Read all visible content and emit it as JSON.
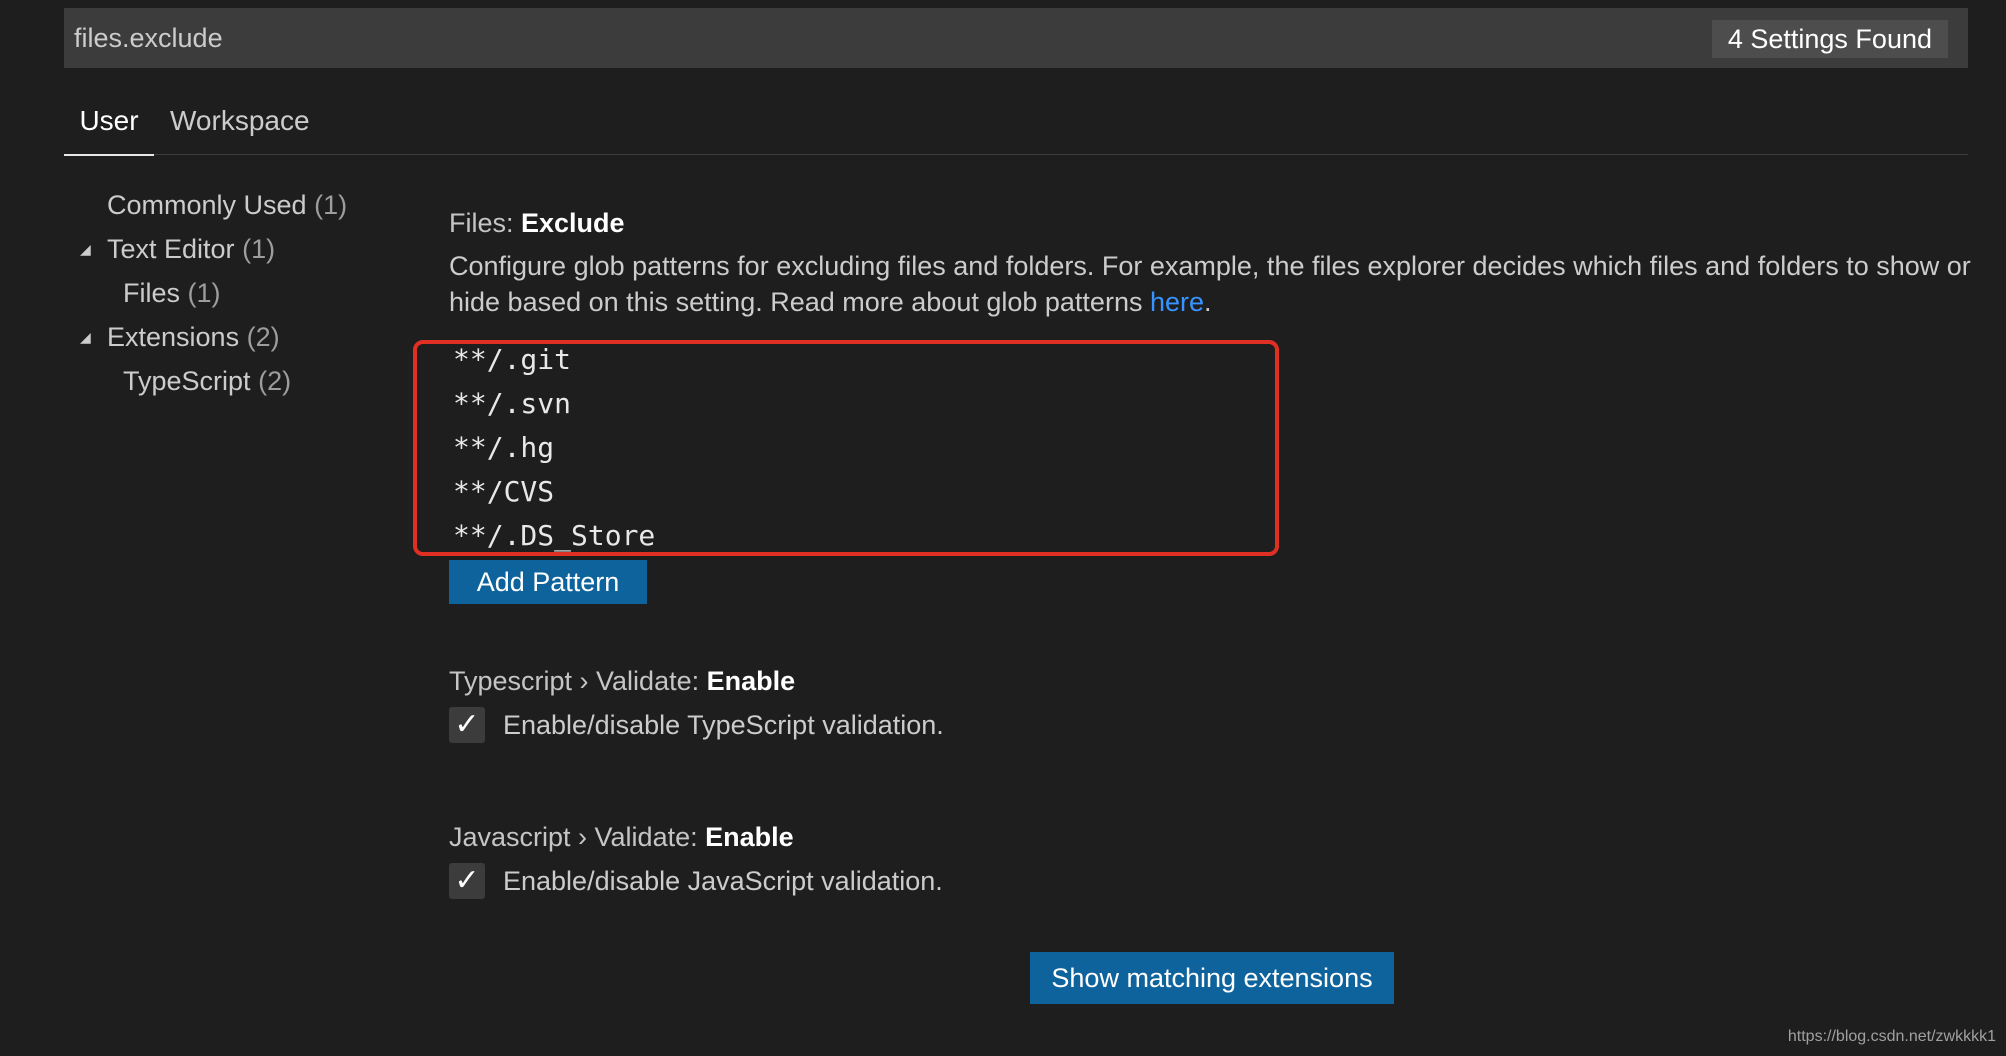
{
  "search": {
    "value": "files.exclude",
    "results_badge": "4 Settings Found"
  },
  "tabs": [
    {
      "label": "User"
    },
    {
      "label": "Workspace"
    }
  ],
  "toc": [
    {
      "label": "Commonly Used",
      "count": "(1)"
    },
    {
      "label": "Text Editor",
      "count": "(1)"
    },
    {
      "label": "Files",
      "count": "(1)"
    },
    {
      "label": "Extensions",
      "count": "(2)"
    },
    {
      "label": "TypeScript",
      "count": "(2)"
    }
  ],
  "settings": {
    "files_exclude": {
      "category": "Files: ",
      "name": "Exclude",
      "description": "Configure glob patterns for excluding files and folders. For example, the files explorer decides which files and folders to show or hide based on this setting. Read more about glob patterns ",
      "link_text": "here",
      "description_end": ".",
      "patterns": [
        "**/.git",
        "**/.svn",
        "**/.hg",
        "**/CVS",
        "**/.DS_Store"
      ],
      "add_button": "Add Pattern"
    },
    "typescript_validate": {
      "category": "Typescript › Validate: ",
      "name": "Enable",
      "checkbox_label": "Enable/disable TypeScript validation.",
      "checked": true
    },
    "javascript_validate": {
      "category": "Javascript › Validate: ",
      "name": "Enable",
      "checkbox_label": "Enable/disable JavaScript validation.",
      "checked": true
    }
  },
  "footer": {
    "show_extensions_button": "Show matching extensions"
  },
  "watermark": "https://blog.csdn.net/zwkkkk1",
  "icons": {
    "checkmark": "✓",
    "expand_arrow": "◢"
  },
  "colors": {
    "background": "#1e1e1e",
    "accent_button": "#0e639c",
    "link": "#3794ff",
    "highlight_border": "#e03024"
  }
}
